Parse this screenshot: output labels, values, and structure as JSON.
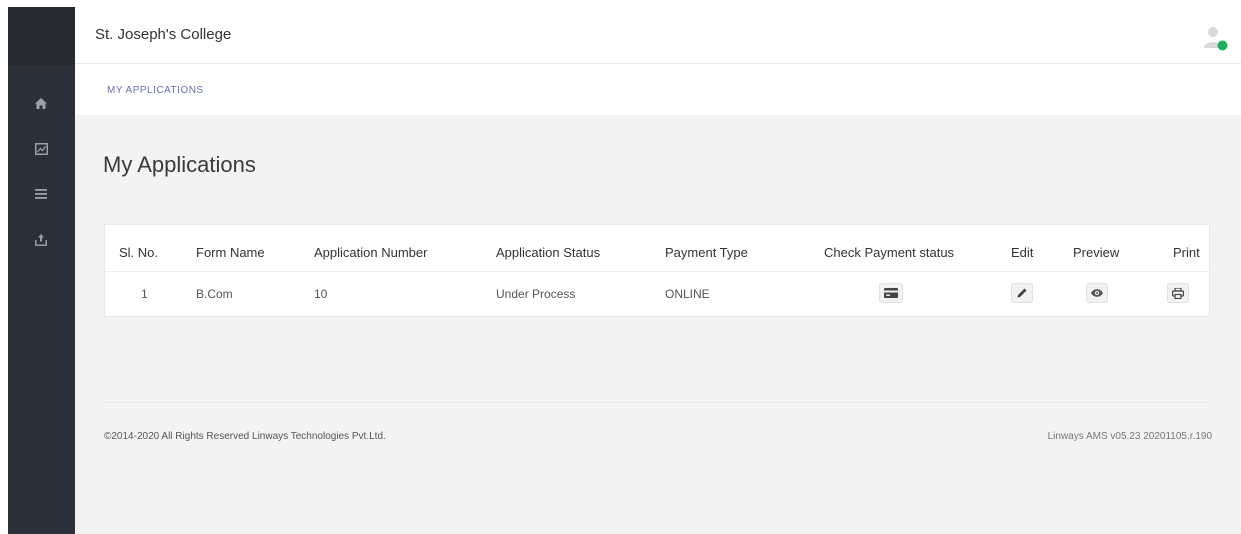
{
  "header": {
    "college_name": "St. Joseph's College"
  },
  "breadcrumb": {
    "label": "MY APPLICATIONS"
  },
  "sidebar": {
    "items": [
      {
        "icon": "home-icon"
      },
      {
        "icon": "image-icon"
      },
      {
        "icon": "menu-icon"
      },
      {
        "icon": "upload-icon"
      }
    ]
  },
  "page": {
    "title": "My Applications"
  },
  "table": {
    "headers": [
      "Sl. No.",
      "Form Name",
      "Application Number",
      "Application Status",
      "Payment Type",
      "Check Payment status",
      "Edit",
      "Preview",
      "Print"
    ],
    "rows": [
      {
        "sl_no": "1",
        "form_name": "B.Com",
        "application_number": "10",
        "application_status": "Under Process",
        "payment_type": "ONLINE",
        "check_payment_icon": "credit-card-icon",
        "edit_icon": "pencil-icon",
        "preview_icon": "eye-icon",
        "print_icon": "printer-icon"
      }
    ]
  },
  "footer": {
    "copyright": "©2014-2020 All Rights Reserved Linways Technologies Pvt.Ltd.",
    "version": "Linways AMS v05.23 20201105.r.190"
  },
  "colors": {
    "sidebar": "#2c3038",
    "breadcrumb": "#6b6fb3",
    "status_online": "#1ab15a",
    "page_bg": "#f3f3f4"
  }
}
